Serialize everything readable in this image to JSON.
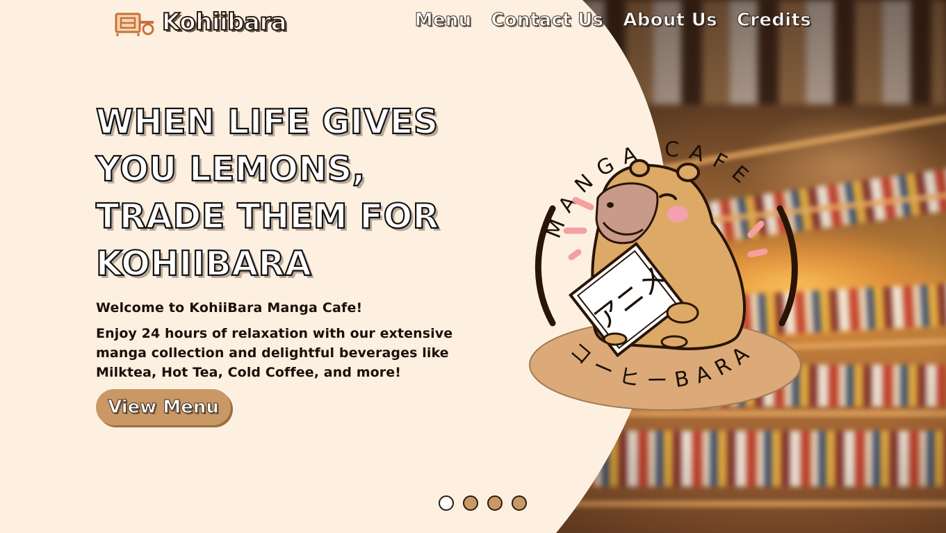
{
  "brand": {
    "name": "Kohiibara",
    "logo_icon": "coffee-shop-sign-icon"
  },
  "nav": {
    "items": [
      {
        "label": "Menu"
      },
      {
        "label": "Contact Us"
      },
      {
        "label": "About Us"
      },
      {
        "label": "Credits"
      }
    ]
  },
  "hero": {
    "headline_line1": "When life gives you lemons,",
    "headline_line2": "trade them for Kohiibara",
    "welcome": "Welcome to KohiiBara Manga Cafe!",
    "description": "Enjoy 24 hours of relaxation with our extensive manga collection and delightful beverages like Milktea, Hot Tea, Cold Coffee, and more!",
    "cta_label": "View Menu"
  },
  "mascot": {
    "top_text": "MANGA CAFE",
    "bottom_text": "コーヒーBARA",
    "book_text": "アニメ",
    "icon": "capybara-reading-manga-icon"
  },
  "carousel": {
    "slides": 4,
    "active_index": 0
  },
  "colors": {
    "cream": "#fdf0e0",
    "tan": "#c99864",
    "dark": "#2a1a10"
  }
}
